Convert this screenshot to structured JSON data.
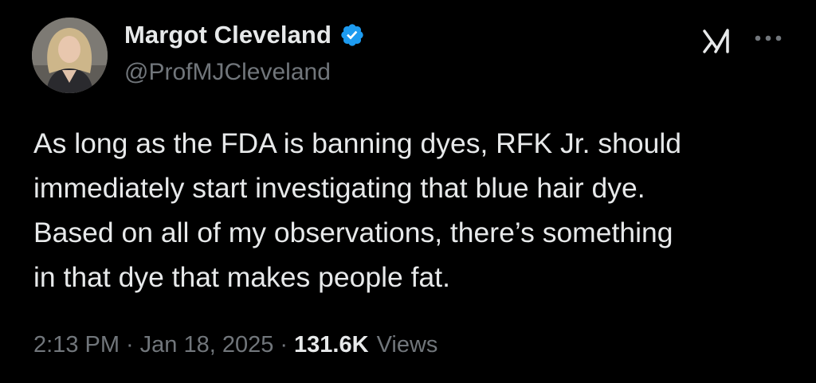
{
  "author": {
    "display_name": "Margot Cleveland",
    "handle": "@ProfMJCleveland",
    "verified": true,
    "verified_color": "#1d9bf0",
    "avatar_icon": "profile-photo"
  },
  "header_actions": {
    "grok_icon": "grok-logo-icon",
    "more_icon": "more-dots-icon"
  },
  "tweet": {
    "text_lines": [
      "As long as the FDA is banning dyes, RFK Jr. should",
      "immediately start investigating that blue hair dye.",
      "Based on all of my observations, there’s something",
      "in that dye that makes people fat."
    ],
    "time": "2:13 PM",
    "separator": "·",
    "date": "Jan 18, 2025",
    "views_count": "131.6K",
    "views_label": "Views"
  },
  "colors": {
    "background": "#000000",
    "primary_text": "#e7e9ea",
    "secondary_text": "#71767b"
  }
}
